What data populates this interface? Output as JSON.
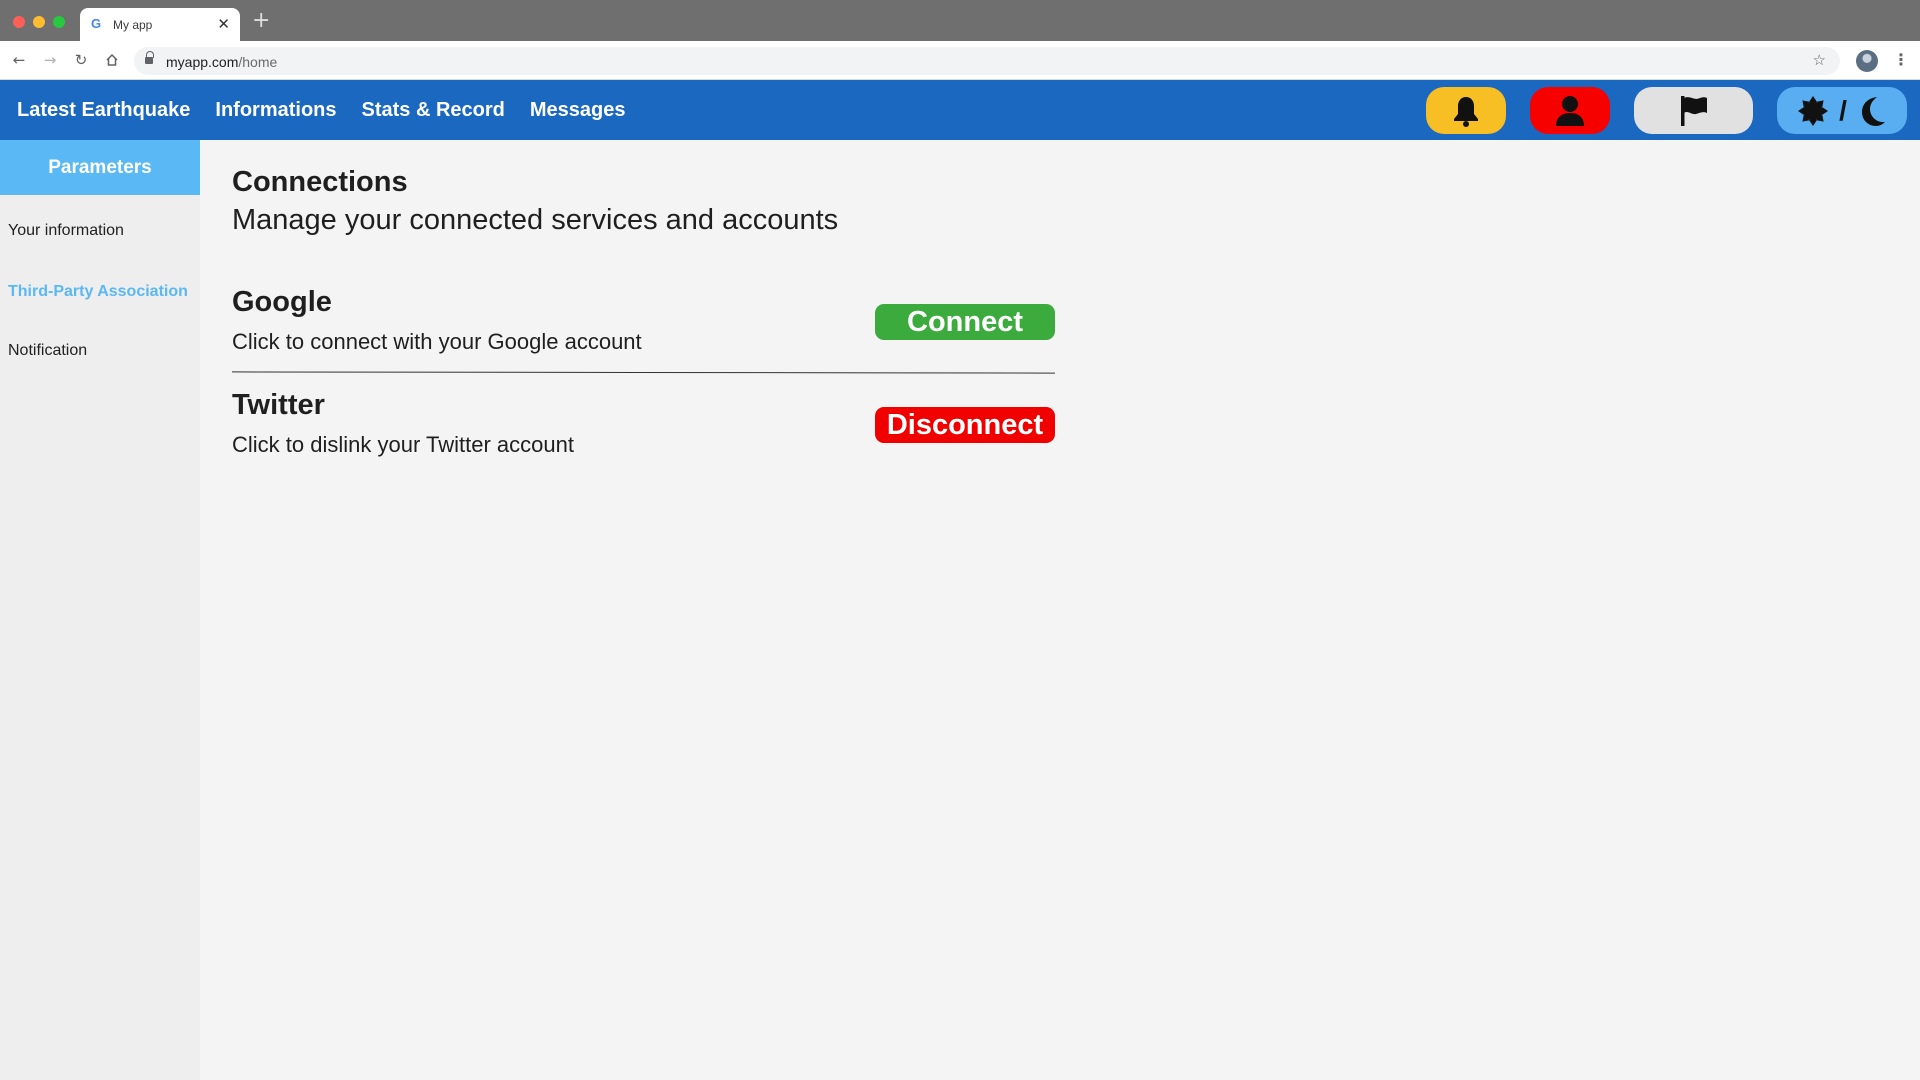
{
  "browser": {
    "tab_title": "My app",
    "favicon": "G",
    "close_glyph": "✕",
    "newtab_glyph": "+",
    "url_domain": "myapp.com",
    "url_path": "/home"
  },
  "header": {
    "nav": [
      "Latest Earthquake",
      "Informations",
      "Stats & Record",
      "Messages"
    ],
    "theme_separator": "/",
    "buttons": {
      "notifications": {
        "icon": "bell-icon",
        "color": "#f7bf23"
      },
      "profile": {
        "icon": "user-icon",
        "color": "#f70000"
      },
      "report": {
        "icon": "flag-icon",
        "color": "#e1e1e1"
      },
      "theme": {
        "icons": [
          "sun-icon",
          "moon-icon"
        ],
        "color": "#58aef0"
      }
    },
    "color": "#1b68c1"
  },
  "sidebar": {
    "title": "Parameters",
    "items": [
      {
        "label": "Your information",
        "active": false
      },
      {
        "label": "Third-Party Association",
        "active": true
      },
      {
        "label": "Notification",
        "active": false
      }
    ],
    "accent": "#5ab8f5"
  },
  "main": {
    "title": "Connections",
    "subtitle": "Manage your connected services and accounts",
    "services": [
      {
        "name": "Google",
        "description": "Click to connect with your Google account",
        "button_label": "Connect",
        "button_color": "#3aab3c"
      },
      {
        "name": "Twitter",
        "description": "Click to dislink your Twitter account",
        "button_label": "Disconnect",
        "button_color": "#f10000"
      }
    ]
  }
}
